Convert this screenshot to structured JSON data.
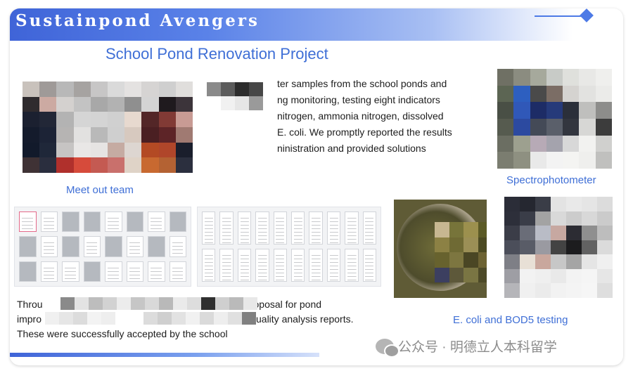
{
  "header": {
    "title": "Sustainpond Avengers"
  },
  "subtitle": "School Pond Renovation Project",
  "monitoring_text": {
    "lines": [
      "ter samples from the school ponds and",
      "ng monitoring, testing eight indicators",
      "nitrogen, ammonia nitrogen, dissolved",
      "E. coli. We promptly reported the results",
      "ninistration and provided solutions"
    ]
  },
  "captions": {
    "team": "Meet out team",
    "spectro": "Spectrophotometer",
    "ecoli": "E. coli and BOD5 testing"
  },
  "proposal_text": {
    "lines": [
      "Throu",
      "impro",
      "These were successfully accepted by the school"
    ],
    "fragments": [
      "ut the process, I authored an 8,000-word proposal for pond",
      "uality analysis reports."
    ]
  },
  "watermark": {
    "text": "公众号 · 明德立人本科留学",
    "icon": "wechat-icon"
  },
  "colors": {
    "accent": "#3f6fd6",
    "banner": "#3f64d8"
  }
}
